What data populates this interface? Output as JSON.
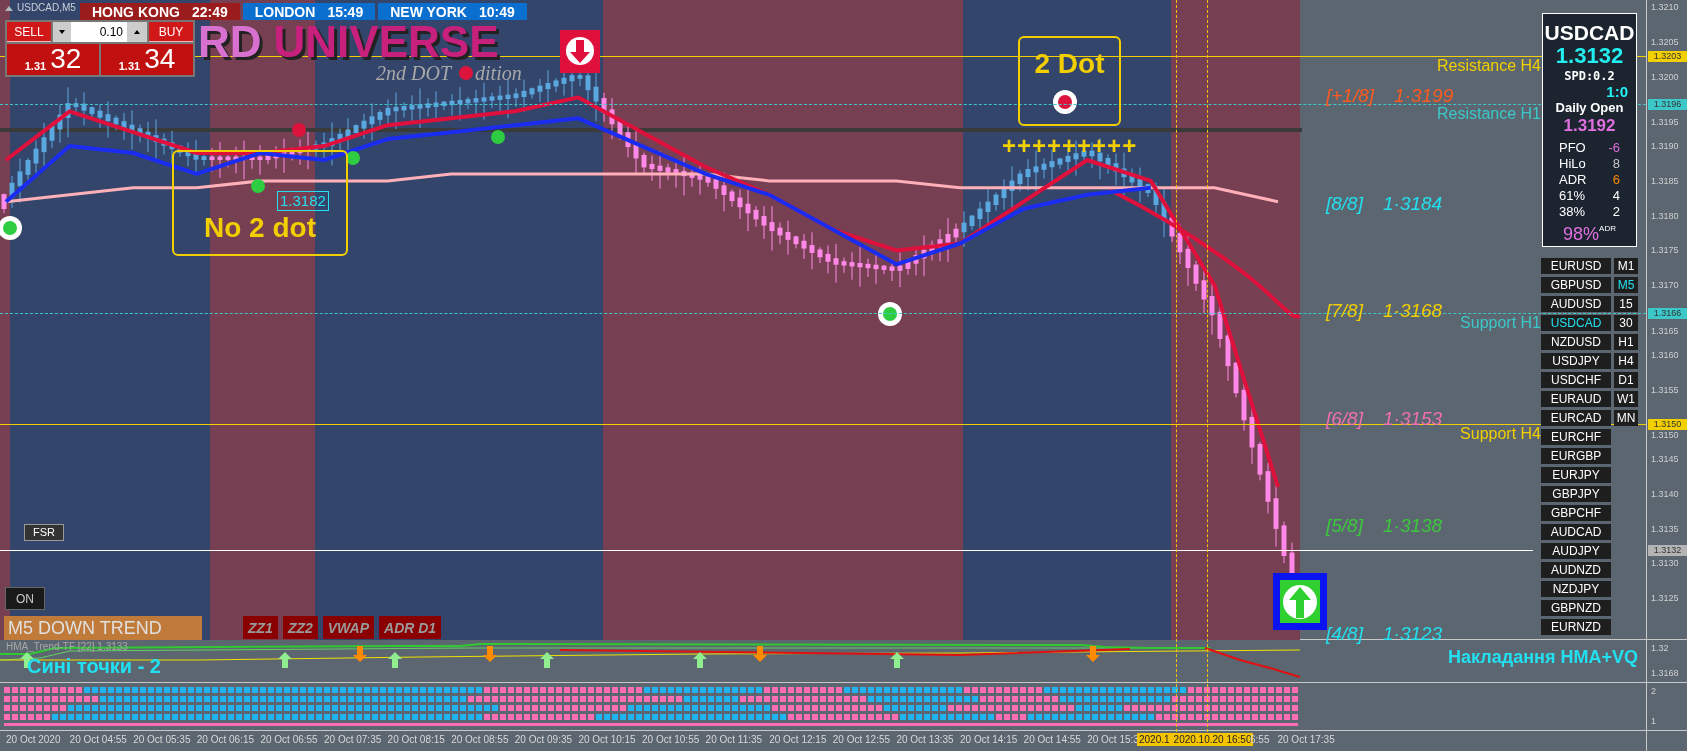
{
  "symbol_label": "USDCAD,M5",
  "sessions": [
    {
      "city": "HONG KONG",
      "time": "22:49",
      "color": "#9b1c1c"
    },
    {
      "city": "LONDON",
      "time": "15:49",
      "color": "#0b6fd0"
    },
    {
      "city": "NEW YORK",
      "time": "10:49",
      "color": "#0b6fd0"
    }
  ],
  "trade_panel": {
    "sell_label": "SELL",
    "buy_label": "BUY",
    "lot": "0.10",
    "sell_prefix": "1.31",
    "sell_pips": "32",
    "buy_prefix": "1.31",
    "buy_pips": "34"
  },
  "logo": {
    "title_light": "RD",
    "title": "UNIVERSE",
    "subtitle_start": "2nd DOT",
    "subtitle_end": "dition"
  },
  "price_lines": [
    {
      "label": "Resistance H4",
      "tag": "1.3203",
      "color": "#f2cf00",
      "kind": "h4"
    },
    {
      "label": "Resistance H1",
      "tag": "1.3196",
      "color": "#3cc8c8",
      "kind": "h1"
    },
    {
      "label": "Support H1",
      "tag": "1.3166",
      "color": "#3cc8c8",
      "kind": "h1"
    },
    {
      "label": "Support H4",
      "tag": "1.3150",
      "color": "#f2cf00",
      "kind": "h4"
    },
    {
      "tag": "1.3132",
      "color": "#ffffff",
      "kind": "current"
    }
  ],
  "murrey_levels": [
    {
      "label": "[+1/8]",
      "value": "1·3199",
      "color": "#ff5a1f"
    },
    {
      "label": "[8/8]",
      "value": "1·3184",
      "color": "#22e0f0"
    },
    {
      "label": "[7/8]",
      "value": "1·3168",
      "color": "#f2cf00"
    },
    {
      "label": "[6/8]",
      "value": "1·3153",
      "color": "#f070b0"
    },
    {
      "label": "[5/8]",
      "value": "1·3138",
      "color": "#3cc83c"
    },
    {
      "label": "[4/8]",
      "value": "1·3123",
      "color": "#22e0f0"
    }
  ],
  "annotations": [
    {
      "text": "No 2 dot"
    },
    {
      "text": "2 Dot"
    }
  ],
  "plus_marks": "+++++++++",
  "price_label": "1.3182",
  "info_panel": {
    "symbol": "USDCAD",
    "price": "1.3132",
    "spread": "SPD:0.2",
    "ratio": "1:0",
    "daily_open_label": "Daily Open",
    "daily_open": "1.3192",
    "stats": [
      {
        "label": "PFO",
        "value": "-6",
        "color": "#e070e0"
      },
      {
        "label": "HiLo",
        "value": "8",
        "color": "#c8c8c8"
      },
      {
        "label": "ADR",
        "value": "6",
        "color": "#ff8c00"
      },
      {
        "label": "61%",
        "value": "4",
        "color": "#ffffff"
      },
      {
        "label": "38%",
        "value": "2",
        "color": "#ffffff"
      }
    ],
    "adr_percent": "98%",
    "adr_suffix": "ADR"
  },
  "symbols": [
    {
      "name": "EURUSD",
      "selected": false
    },
    {
      "name": "GBPUSD",
      "selected": false
    },
    {
      "name": "AUDUSD",
      "selected": false
    },
    {
      "name": "USDCAD",
      "selected": true
    },
    {
      "name": "NZDUSD",
      "selected": false
    },
    {
      "name": "USDJPY",
      "selected": false
    },
    {
      "name": "USDCHF",
      "selected": false
    },
    {
      "name": "EURAUD",
      "selected": false
    },
    {
      "name": "EURCAD",
      "selected": false
    },
    {
      "name": "EURCHF",
      "selected": false
    },
    {
      "name": "EURGBP",
      "selected": false
    },
    {
      "name": "EURJPY",
      "selected": false
    },
    {
      "name": "GBPJPY",
      "selected": false
    },
    {
      "name": "GBPCHF",
      "selected": false
    },
    {
      "name": "AUDCAD",
      "selected": false
    },
    {
      "name": "AUDJPY",
      "selected": false
    },
    {
      "name": "AUDNZD",
      "selected": false
    },
    {
      "name": "NZDJPY",
      "selected": false
    },
    {
      "name": "GBPNZD",
      "selected": false
    },
    {
      "name": "EURNZD",
      "selected": false
    }
  ],
  "timeframes": [
    {
      "name": "M1",
      "selected": false
    },
    {
      "name": "M5",
      "selected": true
    },
    {
      "name": "15",
      "selected": false
    },
    {
      "name": "30",
      "selected": false
    },
    {
      "name": "H1",
      "selected": false
    },
    {
      "name": "H4",
      "selected": false
    },
    {
      "name": "D1",
      "selected": false
    },
    {
      "name": "W1",
      "selected": false
    },
    {
      "name": "MN",
      "selected": false
    }
  ],
  "fsr_button": "FSR",
  "on_button": "ON",
  "trend_label": "M5 DOWN TREND",
  "indicator_buttons": [
    "ZZ1",
    "ZZ2",
    "VWAP",
    "ADR D1"
  ],
  "indicator_1": {
    "name": "HMA_Trend-TF [22] 1.3133",
    "note": "Сині точки - 2",
    "title": "Накладання HMA+VQ",
    "scale": [
      "1.32",
      "1.3168"
    ]
  },
  "indicator_2": {
    "scale": [
      "2",
      "1"
    ]
  },
  "price_axis": [
    "1.3210",
    "1.3205",
    "1.3200",
    "1.3195",
    "1.3190",
    "1.3185",
    "1.3180",
    "1.3175",
    "1.3170",
    "1.3165",
    "1.3160",
    "1.3155",
    "1.3150",
    "1.3145",
    "1.3140",
    "1.3135",
    "1.3130",
    "1.3125"
  ],
  "time_axis": [
    {
      "text": "20 Oct 2020",
      "kind": "tick"
    },
    {
      "text": "20 Oct 04:55",
      "kind": "tick"
    },
    {
      "text": "20 Oct 05:35",
      "kind": "tick"
    },
    {
      "text": "20 Oct 06:15",
      "kind": "tick"
    },
    {
      "text": "20 Oct 06:55",
      "kind": "tick"
    },
    {
      "text": "20 Oct 07:35",
      "kind": "tick"
    },
    {
      "text": "20 Oct 08:15",
      "kind": "tick"
    },
    {
      "text": "20 Oct 08:55",
      "kind": "tick"
    },
    {
      "text": "20 Oct 09:35",
      "kind": "tick"
    },
    {
      "text": "20 Oct 10:15",
      "kind": "tick"
    },
    {
      "text": "20 Oct 10:55",
      "kind": "tick"
    },
    {
      "text": "20 Oct 11:35",
      "kind": "tick"
    },
    {
      "text": "20 Oct 12:15",
      "kind": "tick"
    },
    {
      "text": "20 Oct 12:55",
      "kind": "tick"
    },
    {
      "text": "20 Oct 13:35",
      "kind": "tick"
    },
    {
      "text": "20 Oct 14:15",
      "kind": "tick"
    },
    {
      "text": "20 Oct 14:55",
      "kind": "tick"
    },
    {
      "text": "20 Oct 15:3",
      "kind": "tick"
    },
    {
      "text": "6:55",
      "kind": "tail"
    },
    {
      "text": "20 Oct 17:35",
      "kind": "tail"
    }
  ],
  "cursor_labels": [
    "2020.1",
    "2020.10.20 16:50"
  ]
}
